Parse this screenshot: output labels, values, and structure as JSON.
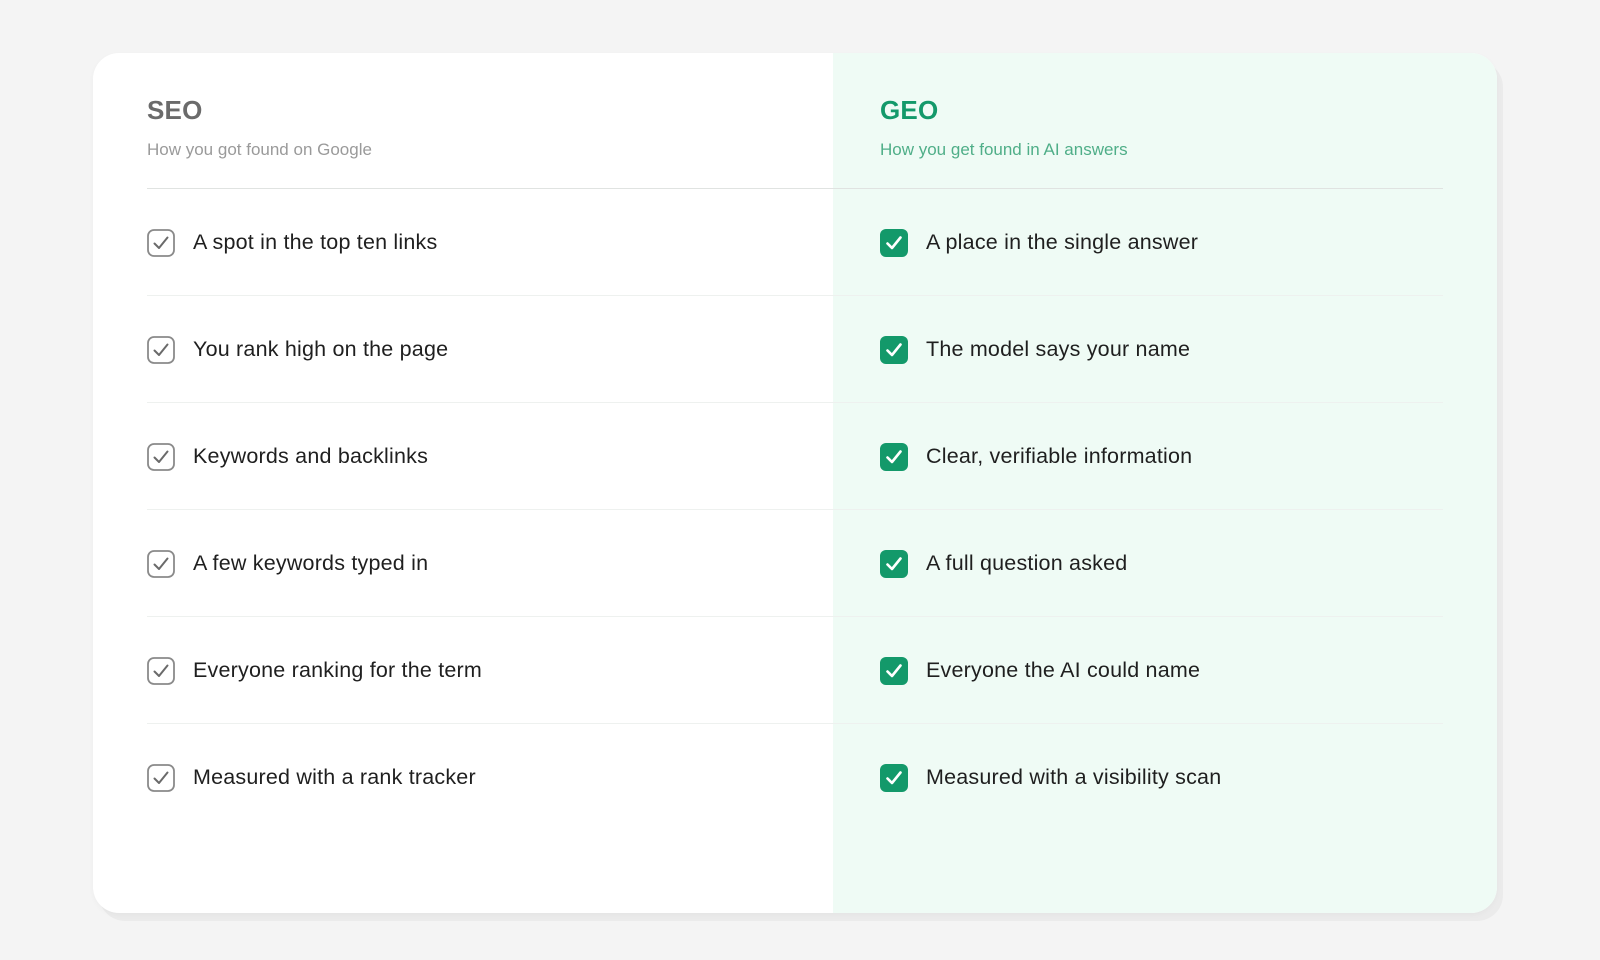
{
  "colors": {
    "page_background": "#f4f4f4",
    "card_background": "#ffffff",
    "geo_column_background": "#effbf5",
    "seo_title": "#6b6b6b",
    "geo_title": "#13996a",
    "geo_check_fill": "#13996a",
    "seo_check_stroke": "#8a8a8a"
  },
  "seo": {
    "title": "SEO",
    "subtitle": "How you got found on Google",
    "check_icon": "outline-check-icon",
    "items": [
      "A spot in the top ten links",
      "You rank high on the page",
      "Keywords and backlinks",
      "A few keywords typed in",
      "Everyone ranking for the term",
      "Measured with a rank tracker"
    ]
  },
  "geo": {
    "title": "GEO",
    "subtitle": "How you get found in AI answers",
    "check_icon": "filled-check-icon",
    "items": [
      "A place in the single answer",
      "The model says your name",
      "Clear, verifiable information",
      "A full question asked",
      "Everyone the AI could name",
      "Measured with a visibility scan"
    ]
  }
}
